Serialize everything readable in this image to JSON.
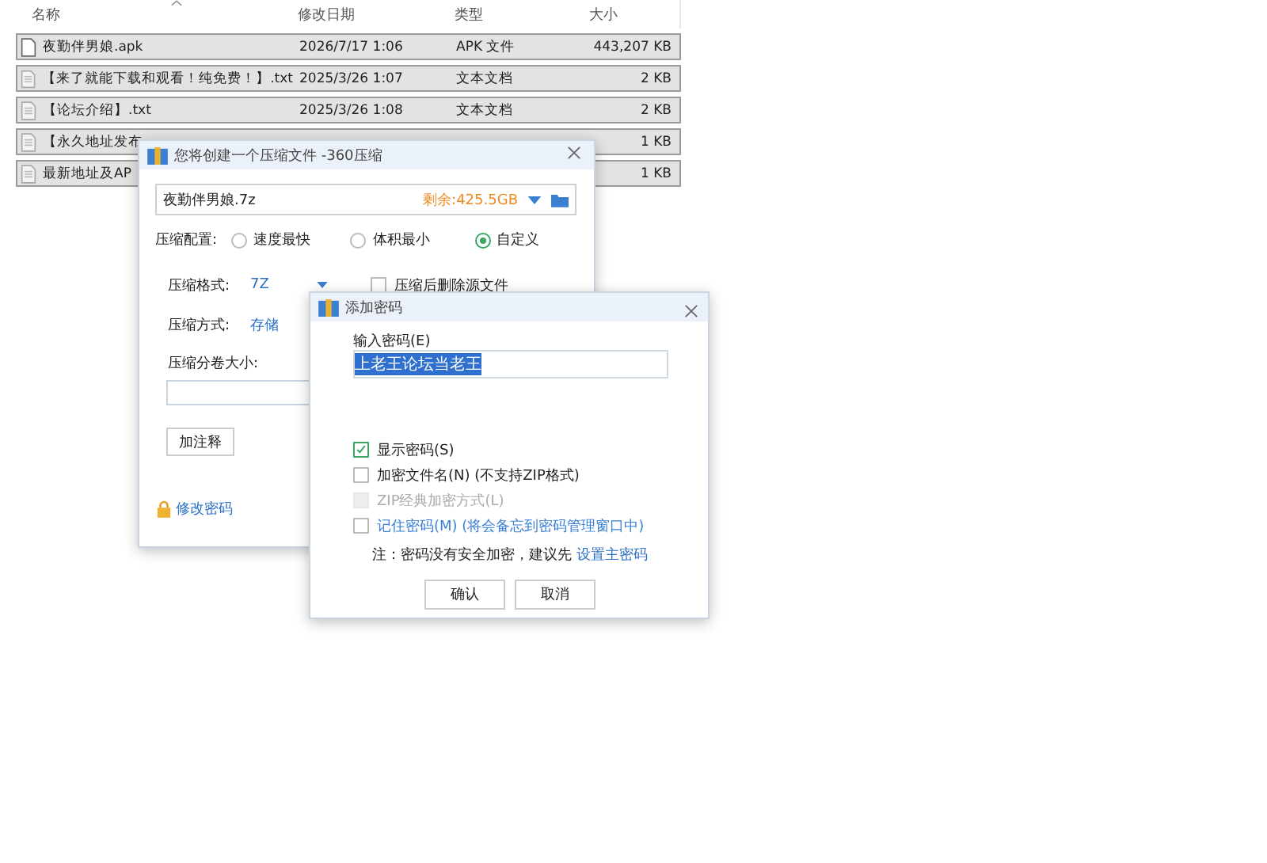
{
  "explorer": {
    "columns": [
      {
        "label": "名称",
        "kind": "name"
      },
      {
        "label": "修改日期",
        "kind": "date"
      },
      {
        "label": "类型",
        "kind": "type"
      },
      {
        "label": "大小",
        "kind": "size"
      }
    ],
    "rows": [
      {
        "name": "夜勤伴男娘.apk",
        "date": "2026/7/17 1:06",
        "type": "APK 文件",
        "size": "443,207 KB",
        "kind": "apk",
        "selected": true
      },
      {
        "name": "【来了就能下载和观看！纯免费！】.txt",
        "date": "2025/3/26 1:07",
        "type": "文本文档",
        "size": "2 KB",
        "kind": "txt",
        "selected": true
      },
      {
        "name": "【论坛介绍】.txt",
        "date": "2025/3/26 1:08",
        "type": "文本文档",
        "size": "2 KB",
        "kind": "txt",
        "selected": true
      },
      {
        "name": "【永久地址发布",
        "size": "1 KB",
        "kind": "txt",
        "selected": true
      },
      {
        "name": "最新地址及AP",
        "size": "1 KB",
        "kind": "txt",
        "selected": true
      }
    ]
  },
  "compress_dialog": {
    "title": "您将创建一个压缩文件 -360压缩",
    "filename": "夜勤伴男娘.7z",
    "free_space": "剩余:425.5GB",
    "profile_label": "压缩配置:",
    "profiles": [
      {
        "label": "速度最快",
        "selected": false
      },
      {
        "label": "体积最小",
        "selected": false
      },
      {
        "label": "自定义",
        "selected": true
      }
    ],
    "format_label": "压缩格式:",
    "format": "7Z",
    "delete_after": {
      "label": "压缩后删除源文件",
      "checked": false
    },
    "method_label": "压缩方式:",
    "method": "存储",
    "volume_label": "压缩分卷大小:",
    "comment_button": "加注释",
    "change_password": "修改密码"
  },
  "password_dialog": {
    "title": "添加密码",
    "input_label": "输入密码(E)",
    "password": "上老王论坛当老王",
    "options": [
      {
        "label": "显示密码(S)",
        "checked": true,
        "disabled": false,
        "kind": "plain"
      },
      {
        "label": "加密文件名(N) (不支持ZIP格式)",
        "checked": false,
        "disabled": false,
        "kind": "plain"
      },
      {
        "label": "ZIP经典加密方式(L)",
        "checked": false,
        "disabled": true,
        "kind": "plain"
      },
      {
        "label": "记住密码(M) (将会备忘到密码管理窗口中)",
        "checked": false,
        "disabled": false,
        "kind": "link"
      }
    ],
    "note": "注：密码没有安全加密，建议先",
    "note_link": "设置主密码",
    "buttons": [
      "确认",
      "取消"
    ]
  }
}
